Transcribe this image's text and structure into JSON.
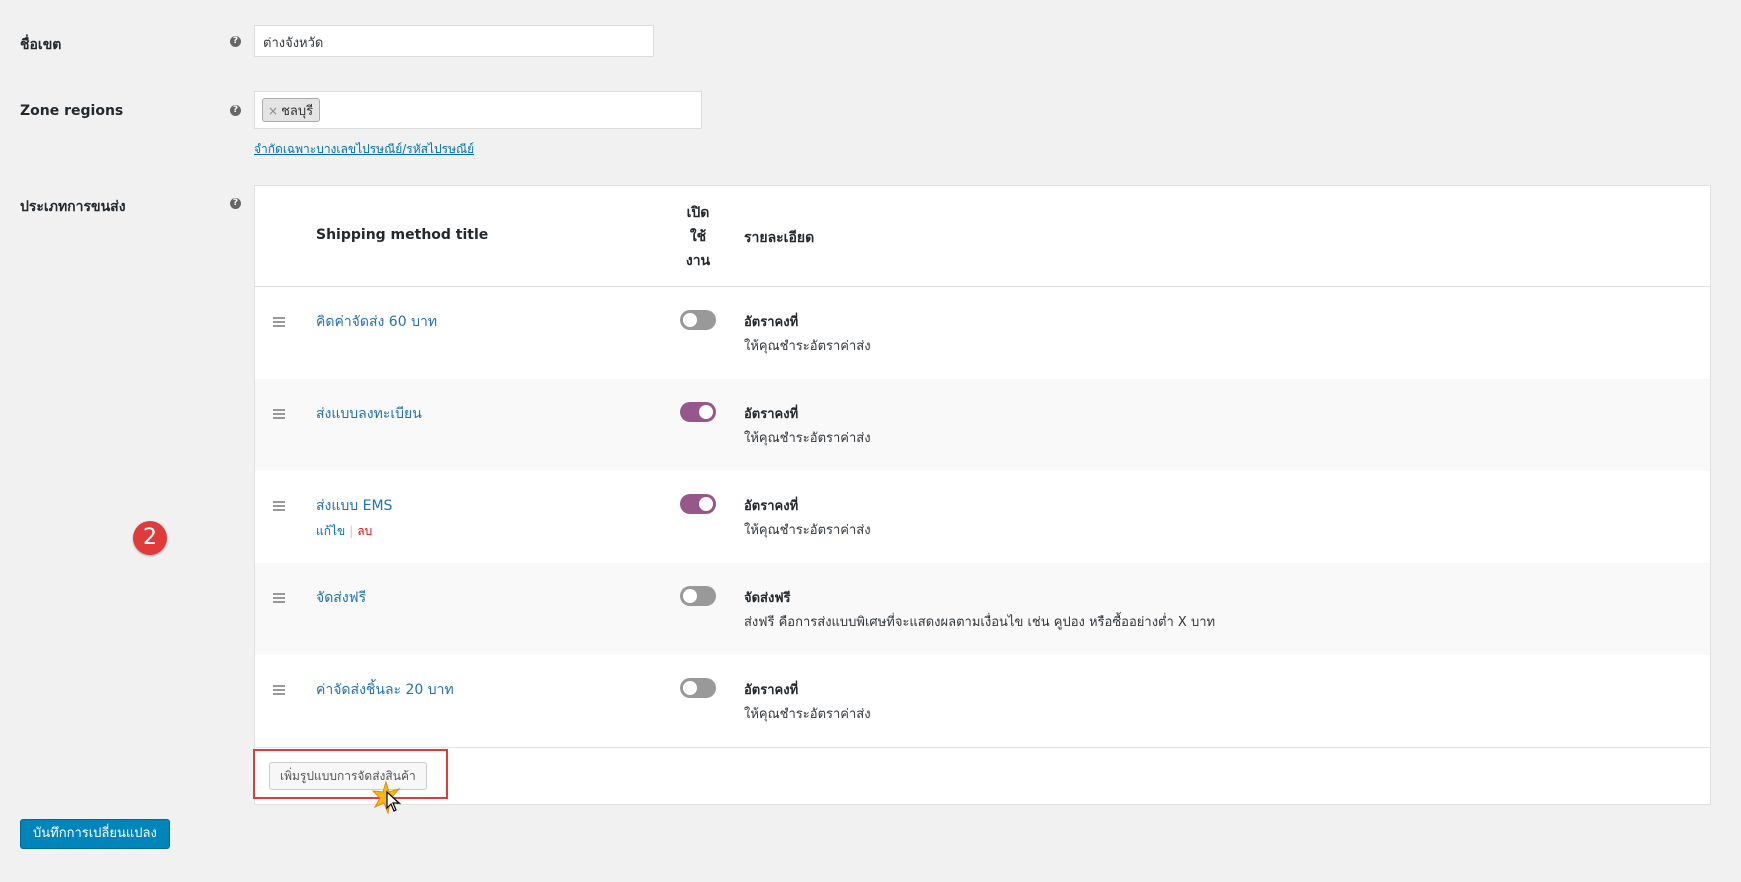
{
  "form": {
    "zone_name_label": "ชื่อเขต",
    "zone_name_value": "ต่างจังหวัด",
    "zone_regions_label": "Zone regions",
    "region_chip": "ชลบุรี",
    "chip_remove": "×",
    "limit_link": "จำกัดเฉพาะบางเลขไปรษณีย์/รหัสไปรษณีย์",
    "shipping_methods_label": "ประเภทการขนส่ง",
    "help_glyph": "?"
  },
  "table": {
    "col_title": "Shipping method title",
    "col_enabled_lines": [
      "เปิด",
      "ใช้",
      "งาน"
    ],
    "col_desc": "รายละเอียด",
    "rows": [
      {
        "title": "คิดค่าจัดส่ง 60 บาท",
        "enabled": false,
        "desc_title": "อัตราคงที่",
        "desc_text": "ให้คุณชำระอัตราค่าส่ง"
      },
      {
        "title": "ส่งแบบลงทะเบียน",
        "enabled": true,
        "desc_title": "อัตราคงที่",
        "desc_text": "ให้คุณชำระอัตราค่าส่ง"
      },
      {
        "title": "ส่งแบบ EMS",
        "enabled": true,
        "desc_title": "อัตราคงที่",
        "desc_text": "ให้คุณชำระอัตราค่าส่ง",
        "edit": "แก้ไข",
        "sep": "|",
        "delete": "ลบ"
      },
      {
        "title": "จัดส่งฟรี",
        "enabled": false,
        "desc_title": "จัดส่งฟรี",
        "desc_text": "ส่งฟรี คือการส่งแบบพิเศษที่จะแสดงผลตามเงื่อนไข เช่น คูปอง หรือซื้ออย่างต่ำ X บาท"
      },
      {
        "title": "ค่าจัดส่งชิ้นละ 20 บาท",
        "enabled": false,
        "desc_title": "อัตราคงที่",
        "desc_text": "ให้คุณชำระอัตราค่าส่ง"
      }
    ],
    "add_button": "เพิ่มรูปแบบการจัดส่งสินค้า"
  },
  "annotation": {
    "step_number": "2"
  },
  "save_button": "บันทึกการเปลี่ยนแปลง",
  "colors": {
    "accent": "#96588a",
    "link": "#2271b1",
    "primary_button": "#0085ba",
    "highlight": "#e03b3b"
  }
}
